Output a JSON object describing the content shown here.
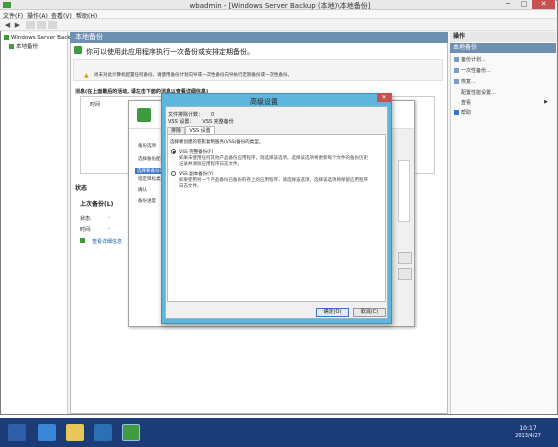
{
  "window": {
    "title": "wbadmin - [Windows Server Backup (本地)\\本地备份]",
    "minimize": "─",
    "maximize": "□",
    "close": "✕"
  },
  "menu": [
    "文件(F)",
    "操作(A)",
    "查看(V)",
    "帮助(H)"
  ],
  "toolbar": {
    "back": "◀",
    "forward": "▶"
  },
  "tree": {
    "root": "Windows Server Backup",
    "child": "本地备份"
  },
  "center": {
    "header": "本地备份",
    "intro": "你可以使用此应用程序执行一次备份或安排定期备份。",
    "warning": "尚未对此计算机配置任何备份。请使用备份计划向导或一次性备份向导执行定期备份或一次性备份。",
    "messages_label": "消息(在上面最后的活动, 请左击下面的消息以查看详细信息)",
    "column_time": "时间",
    "status_label": "状态",
    "last_backup_label": "上次备份(L)",
    "status_key": "状态:",
    "status_value": "-",
    "time_key": "时间:",
    "time_value": "-",
    "view_details": "查看详细信息"
  },
  "actions": {
    "header": "操作",
    "subheader": "本地备份",
    "items": [
      "备份计划...",
      "一次性备份...",
      "恢复...",
      "配置性能设置...",
      "查看",
      "帮助"
    ]
  },
  "wizard": {
    "steps": [
      "备份选项",
      "选择备份配置",
      "选择要备份的项",
      "指定目标类型",
      "确认",
      "备份进度"
    ]
  },
  "dialog": {
    "title": "高级设置",
    "close": "✕",
    "exclusions_key": "文件排除计数：",
    "exclusions_value": "0",
    "vss_key": "VSS 设置：",
    "vss_value": "VSS 完整备份",
    "tab_exclusions": "排除",
    "tab_vss": "VSS 设置",
    "prompt": "选择要创建的卷影复制服务(VSS)备份的类型。",
    "option_full": "VSS 完整备份(F)",
    "option_full_desc": "如果未使用任何其他产品备份应用程序，则选择该选项。选择该选项将更新每个文件的备份历史记录并清除应用程序日志文件。",
    "option_copy": "VSS 副本备份(Y)",
    "option_copy_desc": "如果使用另一个产品备份已备份的卷上的应用程序，请选择该选项。选择该选项将保留应用程序日志文件。",
    "ok": "确定(O)",
    "cancel": "取消(C)"
  },
  "taskbar": {
    "time": "10:17",
    "date": "2013/4/27"
  }
}
